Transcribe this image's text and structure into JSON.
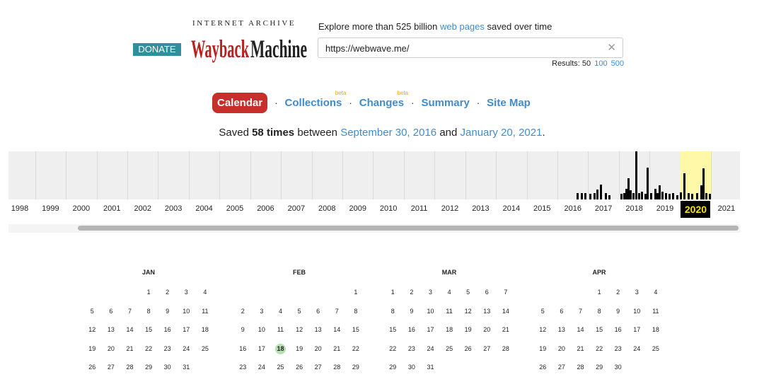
{
  "header": {
    "donate_label": "DONATE",
    "logo_top": "INTERNET ARCHIVE",
    "logo_main": "WaybackMachine",
    "explore_prefix": "Explore more than 525 billion",
    "explore_link": "web pages",
    "explore_suffix": "saved over time",
    "search_value": "https://webwave.me/",
    "results_label": "Results: 50",
    "results_100": "100",
    "results_500": "500"
  },
  "tabs": {
    "calendar": "Calendar",
    "collections": "Collections",
    "changes": "Changes",
    "summary": "Summary",
    "site_map": "Site Map",
    "beta": "beta",
    "separator": "·"
  },
  "saved": {
    "prefix": "Saved",
    "count": "58 times",
    "between": "between",
    "first_date": "September 30, 2016",
    "and": "and",
    "last_date": "January 20, 2021",
    "period": "."
  },
  "timeline": {
    "years": [
      "1998",
      "1999",
      "2000",
      "2001",
      "2002",
      "2003",
      "2004",
      "2005",
      "2006",
      "2007",
      "2008",
      "2009",
      "2010",
      "2011",
      "2012",
      "2013",
      "2014",
      "2015",
      "2016",
      "2017",
      "2018",
      "2019",
      "2020",
      "2021"
    ],
    "selected_year": "2020",
    "highlight_color": "#fff8a8"
  },
  "calendar": {
    "months": [
      {
        "name": "JAN",
        "start": 3,
        "days": 31,
        "captures": []
      },
      {
        "name": "FEB",
        "start": 6,
        "days": 29,
        "captures": [
          18
        ]
      },
      {
        "name": "MAR",
        "start": 0,
        "days": 31,
        "captures": []
      },
      {
        "name": "APR",
        "start": 3,
        "days": 30,
        "captures": []
      }
    ],
    "capture_color": "#b7e0b2"
  },
  "colors": {
    "accent_red": "#c62f2a",
    "link_blue": "#428bca",
    "donate_teal": "#2f8f9d",
    "beta_orange": "#e7a800"
  }
}
